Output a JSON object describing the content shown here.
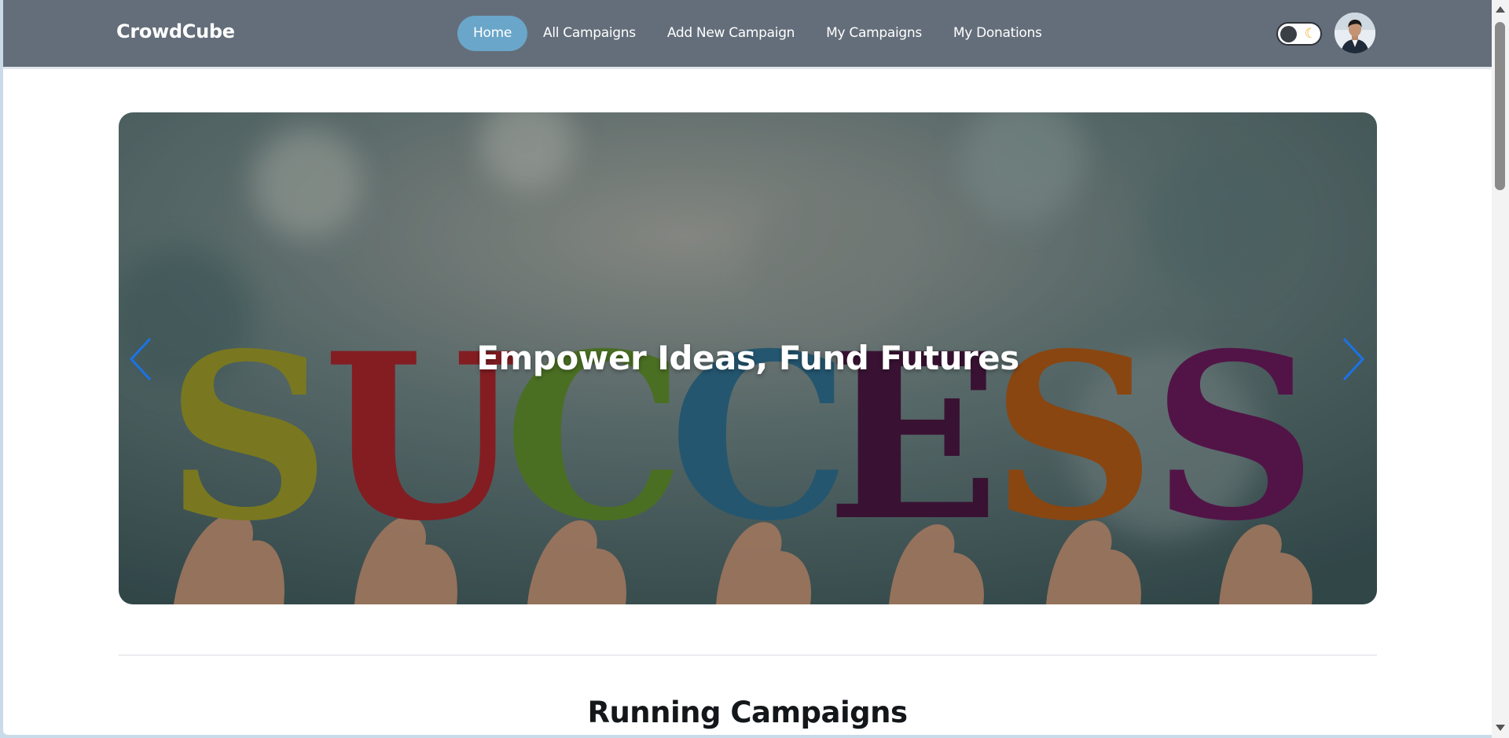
{
  "brand": "CrowdCube",
  "nav": {
    "items": [
      {
        "label": "Home",
        "active": true
      },
      {
        "label": "All Campaigns",
        "active": false
      },
      {
        "label": "Add New Campaign",
        "active": false
      },
      {
        "label": "My Campaigns",
        "active": false
      },
      {
        "label": "My Donations",
        "active": false
      }
    ]
  },
  "theme_toggle": {
    "icon": "moon-icon",
    "state": "light"
  },
  "user": {
    "avatar_icon": "user-avatar"
  },
  "hero": {
    "title": "Empower Ideas, Fund Futures",
    "image_letters": "SUCCESS",
    "prev_icon": "chevron-left-icon",
    "next_icon": "chevron-right-icon"
  },
  "sections": {
    "running_title": "Running Campaigns"
  },
  "colors": {
    "navbar": "#646e7a",
    "active_nav": "#6aa6c9",
    "arrow": "#1a73e8"
  }
}
